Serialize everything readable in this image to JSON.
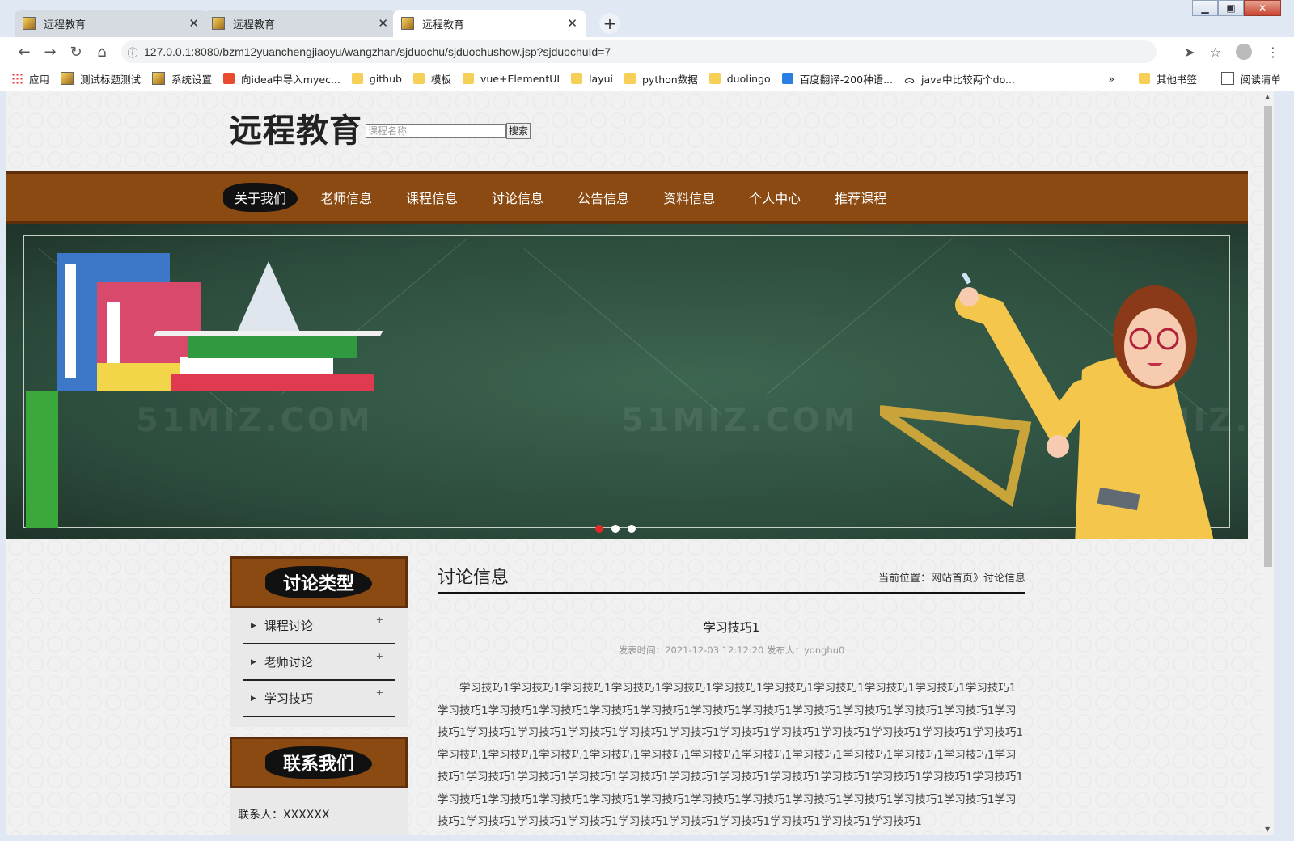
{
  "browser": {
    "tabs": [
      {
        "title": "远程教育",
        "active": false
      },
      {
        "title": "远程教育",
        "active": false
      },
      {
        "title": "远程教育",
        "active": true
      }
    ],
    "url": "127.0.0.1:8080/bzm12yuanchengjiaoyu/wangzhan/sjduochu/sjduochushow.jsp?sjduochuId=7",
    "bookmarks": [
      {
        "label": "应用",
        "icon": "apps-grid-icon"
      },
      {
        "label": "测试标题测试",
        "icon": "image-icon"
      },
      {
        "label": "系统设置",
        "icon": "image-icon"
      },
      {
        "label": "向idea中导入myec...",
        "icon": "red-c-icon"
      },
      {
        "label": "github",
        "icon": "folder-icon"
      },
      {
        "label": "模板",
        "icon": "folder-icon"
      },
      {
        "label": "vue+ElementUI",
        "icon": "folder-icon"
      },
      {
        "label": "layui",
        "icon": "folder-icon"
      },
      {
        "label": "python数据",
        "icon": "folder-icon"
      },
      {
        "label": "duolingo",
        "icon": "folder-icon"
      },
      {
        "label": "百度翻译-200种语...",
        "icon": "translate-icon"
      },
      {
        "label": "java中比较两个do...",
        "icon": "bird-icon"
      }
    ],
    "bookmarks_more": "»",
    "other_bookmarks": "其他书签",
    "reading_list": "阅读清单"
  },
  "site": {
    "logo": "远程教育",
    "search_placeholder": "课程名称",
    "search_button": "搜索",
    "menu": [
      "关于我们",
      "老师信息",
      "课程信息",
      "讨论信息",
      "公告信息",
      "资料信息",
      "个人中心",
      "推荐课程"
    ],
    "active_menu": "关于我们",
    "banner_watermark": "51MIZ.COM",
    "carousel": {
      "count": 3,
      "active": 1
    }
  },
  "sidebar": {
    "category_title": "讨论类型",
    "categories": [
      "课程讨论",
      "老师讨论",
      "学习技巧"
    ],
    "contact_title": "联系我们",
    "contact_person": "联系人：XXXXXX"
  },
  "main": {
    "section_title": "讨论信息",
    "breadcrumb": "当前位置：网站首页》讨论信息",
    "article": {
      "title": "学习技巧1",
      "meta": "发表时间：2021-12-03 12:12:20 发布人：yonghu0",
      "body": "学习技巧1学习技巧1学习技巧1学习技巧1学习技巧1学习技巧1学习技巧1学习技巧1学习技巧1学习技巧1学习技巧1学习技巧1学习技巧1学习技巧1学习技巧1学习技巧1学习技巧1学习技巧1学习技巧1学习技巧1学习技巧1学习技巧1学习技巧1学习技巧1学习技巧1学习技巧1学习技巧1学习技巧1学习技巧1学习技巧1学习技巧1学习技巧1学习技巧1学习技巧1学习技巧1学习技巧1学习技巧1学习技巧1学习技巧1学习技巧1学习技巧1学习技巧1学习技巧1学习技巧1学习技巧1学习技巧1学习技巧1学习技巧1学习技巧1学习技巧1学习技巧1学习技巧1学习技巧1学习技巧1学习技巧1学习技巧1学习技巧1学习技巧1学习技巧1学习技巧1学习技巧1学习技巧1学习技巧1学习技巧1学习技巧1学习技巧1学习技巧1学习技巧1学习技巧1学习技巧1学习技巧1学习技巧1学习技巧1学习技巧1学习技巧1学习技巧1学习技巧1学习技巧1"
    }
  }
}
